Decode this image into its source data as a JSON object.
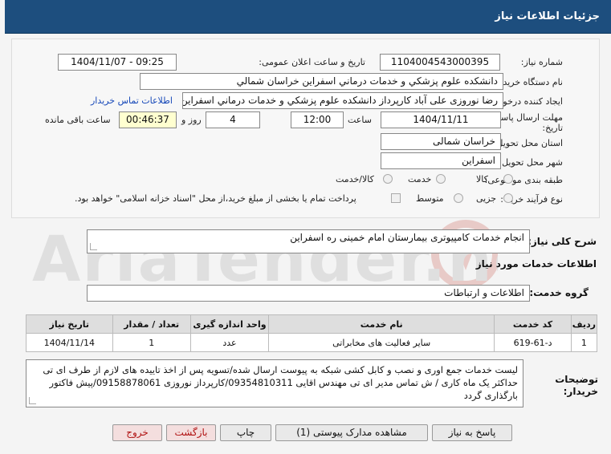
{
  "header": {
    "title": "جزئیات اطلاعات نیاز"
  },
  "form": {
    "need_number_label": "شماره نیاز:",
    "need_number": "1104004543000395",
    "announce_label": "تاریخ و ساعت اعلان عمومی:",
    "announce_value": "1404/11/07 - 09:25",
    "buyer_label": "نام دستگاه خریدار:",
    "buyer_value": "دانشکده علوم پزشکي و خدمات درماني اسفراين خراسان شمالي",
    "creator_label": "ایجاد کننده درخواست:",
    "creator_value": "رضا نوروزی علی آباد کارپرداز  دانشکده علوم پزشکي و خدمات درماني اسفراين خراسان شمالي",
    "contact_link": "اطلاعات تماس خریدار",
    "deadline_label_1": "مهلت ارسال پاسخ: تا",
    "deadline_label_2": "تاریخ:",
    "deadline_date": "1404/11/11",
    "time_label": "ساعت",
    "deadline_time": "12:00",
    "days_value": "4",
    "days_label": "روز و",
    "remaining_value": "00:46:37",
    "remaining_label": "ساعت باقی مانده",
    "province_label": "استان محل تحویل:",
    "province_value": "خراسان شمالی",
    "city_label": "شهر محل تحویل:",
    "city_value": "اسفراین",
    "category_label": "طبقه بندی موضوعی:",
    "category_options": [
      "کالا",
      "خدمت",
      "کالا/خدمت"
    ],
    "process_label": "نوع فرآیند خرید :",
    "process_options": [
      "جزیی",
      "متوسط"
    ],
    "payment_note": "پرداخت تمام یا بخشی از مبلغ خرید،از محل \"اسناد خزانه اسلامی\" خواهد بود."
  },
  "summary": {
    "label": "شرح کلی نیاز:",
    "value": "انجام خدمات کامپیوتری بیمارستان امام خمینی ره اسفراین"
  },
  "services": {
    "section_title": "اطلاعات خدمات مورد نیاز",
    "group_label": "گروه خدمت:",
    "group_value": "اطلاعات و ارتباطات",
    "columns": [
      "ردیف",
      "کد خدمت",
      "نام خدمت",
      "واحد اندازه گیری",
      "تعداد / مقدار",
      "تاریخ نیاز"
    ],
    "rows": [
      [
        "1",
        "د-61-619",
        "سایر فعالیت های مخابراتی",
        "عدد",
        "1",
        "1404/11/14"
      ]
    ]
  },
  "buyer_notes": {
    "label_1": "توضیحات",
    "label_2": "خریدار:",
    "value": "لیست خدمات جمع اوری و نصب و کابل کشی شبکه به پیوست ارسال شده/تسویه پس از اخذ تاییده های لازم از طرف ای تی حداکثر یک ماه کاری / ش تماس مدیر ای تی مهندس اقایی 09354810311/کارپرداز نوروزی 09158878061/پیش فاکتور بارگذاری گردد"
  },
  "buttons": {
    "reply": "پاسخ به نیاز",
    "attachments": "مشاهده مدارک پیوستی (1)",
    "print": "چاپ",
    "back": "بازگشت",
    "exit": "خروج"
  },
  "colors": {
    "header_bg": "#1d4e7e",
    "link": "#1547b8",
    "watermark": "#c0392b"
  }
}
